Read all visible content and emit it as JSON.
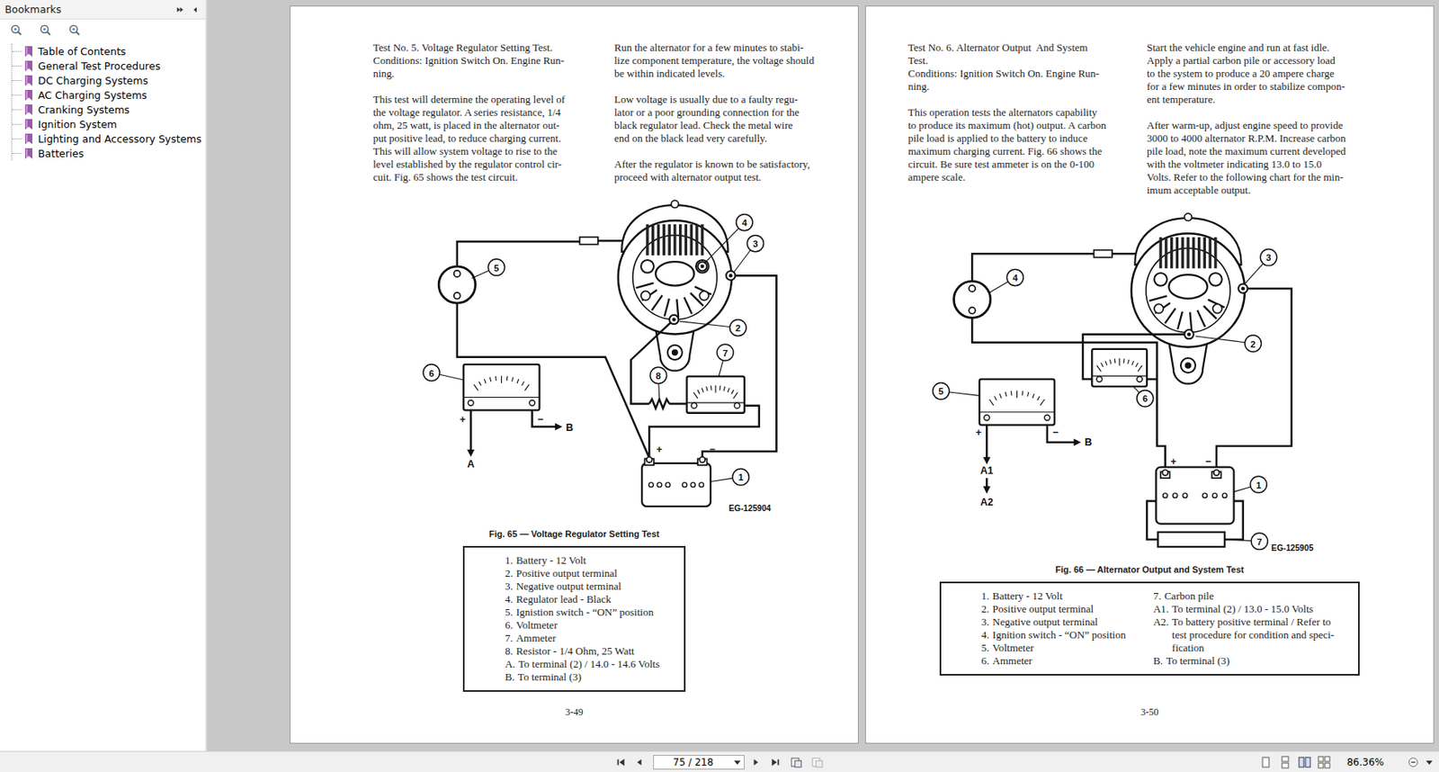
{
  "sidebar": {
    "title": "Bookmarks",
    "items": [
      {
        "label": "Table of Contents",
        "selected": false
      },
      {
        "label": "General Test Procedures",
        "selected": false
      },
      {
        "label": "DC Charging Systems",
        "selected": false
      },
      {
        "label": "AC Charging Systems",
        "selected": false
      },
      {
        "label": "Cranking Systems",
        "selected": false
      },
      {
        "label": "Ignition System",
        "selected": false
      },
      {
        "label": "Lighting and Accessory Systems",
        "selected": false
      },
      {
        "label": "Batteries",
        "selected": false
      }
    ]
  },
  "pages": [
    {
      "number": "3-49",
      "columns": [
        [
          [
            "Test No. 5. Voltage Regulator Setting Test.",
            "Conditions: Ignition Switch On. Engine Run-",
            "ning."
          ],
          [
            "This test will determine the operating level of",
            "the voltage regulator. A series resistance, 1/4",
            "ohm, 25 watt, is placed in the alternator out-",
            "put positive lead, to reduce charging current.",
            "This will allow system voltage to rise to the",
            "level established by the regulator control cir-",
            "cuit. Fig. 65 shows the test circuit."
          ]
        ],
        [
          [
            "Run the alternator for a few minutes to stabi-",
            "lize component temperature, the voltage should",
            "be within indicated levels."
          ],
          [
            "Low voltage is usually due to a faulty regu-",
            "lator or a poor grounding connection for the",
            "black regulator lead. Check the metal wire",
            "end on the black lead very carefully."
          ],
          [
            "After the regulator is known to be satisfactory,",
            "proceed with alternator output test."
          ]
        ]
      ],
      "figure": {
        "kind": "regulator-test",
        "callouts": [
          "1",
          "2",
          "3",
          "4",
          "5",
          "6",
          "7",
          "8"
        ],
        "marks": [
          "+",
          "−",
          "A",
          "B",
          "+",
          "−"
        ],
        "code": "EG-125904"
      },
      "caption": "Fig. 65 — Voltage Regulator Setting Test",
      "legend": [
        [
          {
            "marker": "1.",
            "lines": [
              "Battery - 12 Volt"
            ]
          },
          {
            "marker": "2.",
            "lines": [
              "Positive output terminal"
            ]
          },
          {
            "marker": "3.",
            "lines": [
              "Negative output terminal"
            ]
          },
          {
            "marker": "4.",
            "lines": [
              "Regulator lead - Black"
            ]
          },
          {
            "marker": "5.",
            "lines": [
              "Ignistion switch - “ON” position"
            ]
          },
          {
            "marker": "6.",
            "lines": [
              "Voltmeter"
            ]
          },
          {
            "marker": "7.",
            "lines": [
              "Ammeter"
            ]
          },
          {
            "marker": "8.",
            "lines": [
              "Resistor - 1/4 Ohm, 25 Watt"
            ]
          },
          {
            "marker": "A.",
            "lines": [
              "To terminal (2) / 14.0 - 14.6 Volts"
            ]
          },
          {
            "marker": "B.",
            "lines": [
              "To terminal (3)"
            ]
          }
        ]
      ]
    },
    {
      "number": "3-50",
      "columns": [
        [
          [
            "Test No. 6. Alternator Output  And System",
            "Test.",
            "Conditions: Ignition Switch On. Engine Run-",
            "ning."
          ],
          [
            "This operation tests the alternators capability",
            "to produce its maximum (hot) output. A carbon",
            "pile load is applied to the battery to induce",
            "maximum charging current. Fig. 66 shows the",
            "circuit. Be sure test ammeter is on the 0-100",
            "ampere scale."
          ]
        ],
        [
          [
            "Start the vehicle engine and run at fast idle.",
            "Apply a partial carbon pile or accessory load",
            "to the system to produce a 20 ampere charge",
            "for a few minutes in order to stabilize compon-",
            "ent temperature."
          ],
          [
            "After warm-up, adjust engine speed to provide",
            "3000 to 4000 alternator R.P.M. Increase carbon",
            "pile load, note the maximum current developed",
            "with the voltmeter indicating 13.0 to 15.0",
            "Volts. Refer to the following chart for the min-",
            "imum acceptable output."
          ]
        ]
      ],
      "figure": {
        "kind": "output-test",
        "callouts": [
          "1",
          "2",
          "3",
          "4",
          "5",
          "6",
          "7"
        ],
        "marks": [
          "+",
          "−",
          "A1",
          "A2",
          "B",
          "+",
          "−"
        ],
        "code": "EG-125905"
      },
      "caption": "Fig. 66 — Alternator Output and System Test",
      "legend": [
        [
          {
            "marker": "1.",
            "lines": [
              "Battery - 12 Volt"
            ]
          },
          {
            "marker": "2.",
            "lines": [
              "Positive output terminal"
            ]
          },
          {
            "marker": "3.",
            "lines": [
              "Negative output terminal"
            ]
          },
          {
            "marker": "4.",
            "lines": [
              "Ignition switch - “ON” position"
            ]
          },
          {
            "marker": "5.",
            "lines": [
              "Voltmeter"
            ]
          },
          {
            "marker": "6.",
            "lines": [
              "Ammeter"
            ]
          }
        ],
        [
          {
            "marker": "7.",
            "lines": [
              "Carbon pile"
            ]
          },
          {
            "marker": "A1.",
            "lines": [
              "To terminal (2) / 13.0 - 15.0 Volts"
            ]
          },
          {
            "marker": "A2.",
            "lines": [
              "To battery positive terminal / Refer to",
              "test procedure for condition and speci-",
              "fication"
            ]
          },
          {
            "marker": "B.",
            "lines": [
              "To terminal (3)"
            ]
          }
        ]
      ]
    }
  ],
  "toolbar": {
    "page_field": "75 / 218",
    "zoom": "86.36%"
  }
}
